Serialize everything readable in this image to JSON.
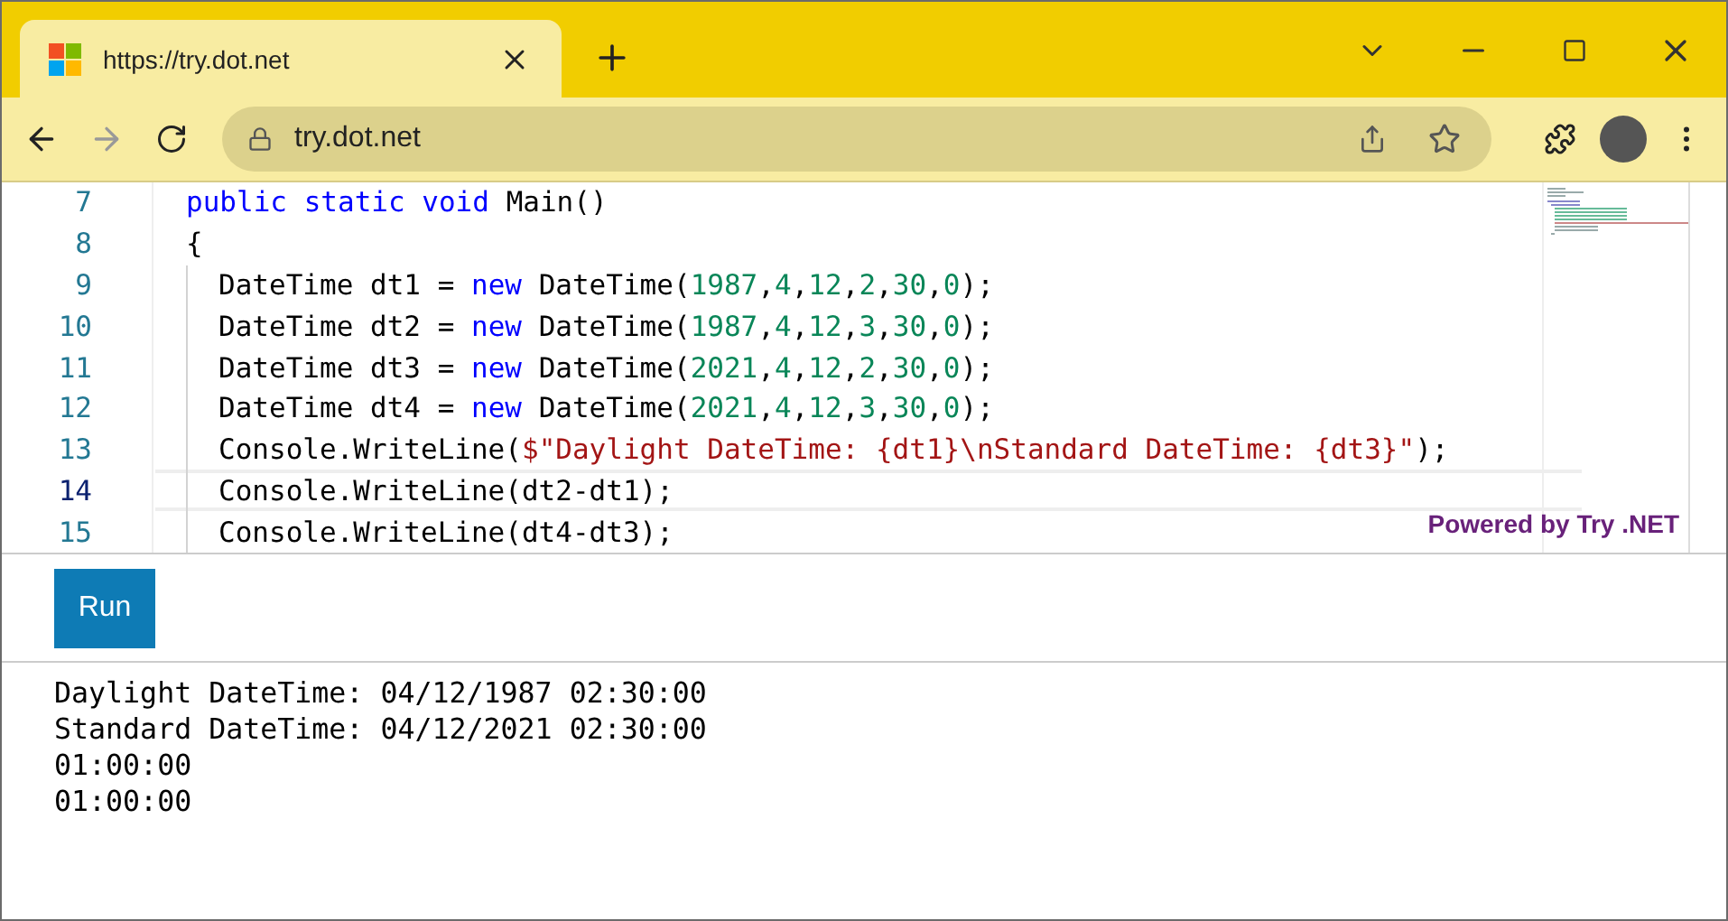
{
  "browser": {
    "tab_title": "https://try.dot.net",
    "address": "try.dot.net"
  },
  "editor": {
    "lines": [
      {
        "number": "7",
        "current": false,
        "indented": false,
        "tokens": [
          {
            "kind": "kw",
            "text": "public static void"
          },
          {
            "kind": "plain",
            "text": " Main()"
          }
        ]
      },
      {
        "number": "8",
        "current": false,
        "indented": false,
        "tokens": [
          {
            "kind": "plain",
            "text": "{"
          }
        ]
      },
      {
        "number": "9",
        "current": false,
        "indented": true,
        "tokens": [
          {
            "kind": "plain",
            "text": "DateTime dt1 = "
          },
          {
            "kind": "kw",
            "text": "new"
          },
          {
            "kind": "plain",
            "text": " DateTime("
          },
          {
            "kind": "num",
            "text": "1987"
          },
          {
            "kind": "plain",
            "text": ","
          },
          {
            "kind": "num",
            "text": "4"
          },
          {
            "kind": "plain",
            "text": ","
          },
          {
            "kind": "num",
            "text": "12"
          },
          {
            "kind": "plain",
            "text": ","
          },
          {
            "kind": "num",
            "text": "2"
          },
          {
            "kind": "plain",
            "text": ","
          },
          {
            "kind": "num",
            "text": "30"
          },
          {
            "kind": "plain",
            "text": ","
          },
          {
            "kind": "num",
            "text": "0"
          },
          {
            "kind": "plain",
            "text": ");"
          }
        ]
      },
      {
        "number": "10",
        "current": false,
        "indented": true,
        "tokens": [
          {
            "kind": "plain",
            "text": "DateTime dt2 = "
          },
          {
            "kind": "kw",
            "text": "new"
          },
          {
            "kind": "plain",
            "text": " DateTime("
          },
          {
            "kind": "num",
            "text": "1987"
          },
          {
            "kind": "plain",
            "text": ","
          },
          {
            "kind": "num",
            "text": "4"
          },
          {
            "kind": "plain",
            "text": ","
          },
          {
            "kind": "num",
            "text": "12"
          },
          {
            "kind": "plain",
            "text": ","
          },
          {
            "kind": "num",
            "text": "3"
          },
          {
            "kind": "plain",
            "text": ","
          },
          {
            "kind": "num",
            "text": "30"
          },
          {
            "kind": "plain",
            "text": ","
          },
          {
            "kind": "num",
            "text": "0"
          },
          {
            "kind": "plain",
            "text": ");"
          }
        ]
      },
      {
        "number": "11",
        "current": false,
        "indented": true,
        "tokens": [
          {
            "kind": "plain",
            "text": "DateTime dt3 = "
          },
          {
            "kind": "kw",
            "text": "new"
          },
          {
            "kind": "plain",
            "text": " DateTime("
          },
          {
            "kind": "num",
            "text": "2021"
          },
          {
            "kind": "plain",
            "text": ","
          },
          {
            "kind": "num",
            "text": "4"
          },
          {
            "kind": "plain",
            "text": ","
          },
          {
            "kind": "num",
            "text": "12"
          },
          {
            "kind": "plain",
            "text": ","
          },
          {
            "kind": "num",
            "text": "2"
          },
          {
            "kind": "plain",
            "text": ","
          },
          {
            "kind": "num",
            "text": "30"
          },
          {
            "kind": "plain",
            "text": ","
          },
          {
            "kind": "num",
            "text": "0"
          },
          {
            "kind": "plain",
            "text": ");"
          }
        ]
      },
      {
        "number": "12",
        "current": false,
        "indented": true,
        "tokens": [
          {
            "kind": "plain",
            "text": "DateTime dt4 = "
          },
          {
            "kind": "kw",
            "text": "new"
          },
          {
            "kind": "plain",
            "text": " DateTime("
          },
          {
            "kind": "num",
            "text": "2021"
          },
          {
            "kind": "plain",
            "text": ","
          },
          {
            "kind": "num",
            "text": "4"
          },
          {
            "kind": "plain",
            "text": ","
          },
          {
            "kind": "num",
            "text": "12"
          },
          {
            "kind": "plain",
            "text": ","
          },
          {
            "kind": "num",
            "text": "3"
          },
          {
            "kind": "plain",
            "text": ","
          },
          {
            "kind": "num",
            "text": "30"
          },
          {
            "kind": "plain",
            "text": ","
          },
          {
            "kind": "num",
            "text": "0"
          },
          {
            "kind": "plain",
            "text": ");"
          }
        ]
      },
      {
        "number": "13",
        "current": false,
        "indented": true,
        "tokens": [
          {
            "kind": "plain",
            "text": "Console.WriteLine("
          },
          {
            "kind": "str",
            "text": "$\"Daylight DateTime: {dt1}\\nStandard DateTime: {dt3}\""
          },
          {
            "kind": "plain",
            "text": ");"
          }
        ]
      },
      {
        "number": "14",
        "current": true,
        "indented": true,
        "tokens": [
          {
            "kind": "plain",
            "text": "Console.WriteLine(dt2-dt1);"
          }
        ]
      },
      {
        "number": "15",
        "current": false,
        "indented": true,
        "tokens": [
          {
            "kind": "plain",
            "text": "Console.WriteLine(dt4-dt3);"
          }
        ]
      }
    ],
    "powered_by": "Powered by Try .NET"
  },
  "run_button": "Run",
  "output": [
    "Daylight DateTime: 04/12/1987 02:30:00",
    "Standard DateTime: 04/12/2021 02:30:00",
    "01:00:00",
    "01:00:00"
  ]
}
